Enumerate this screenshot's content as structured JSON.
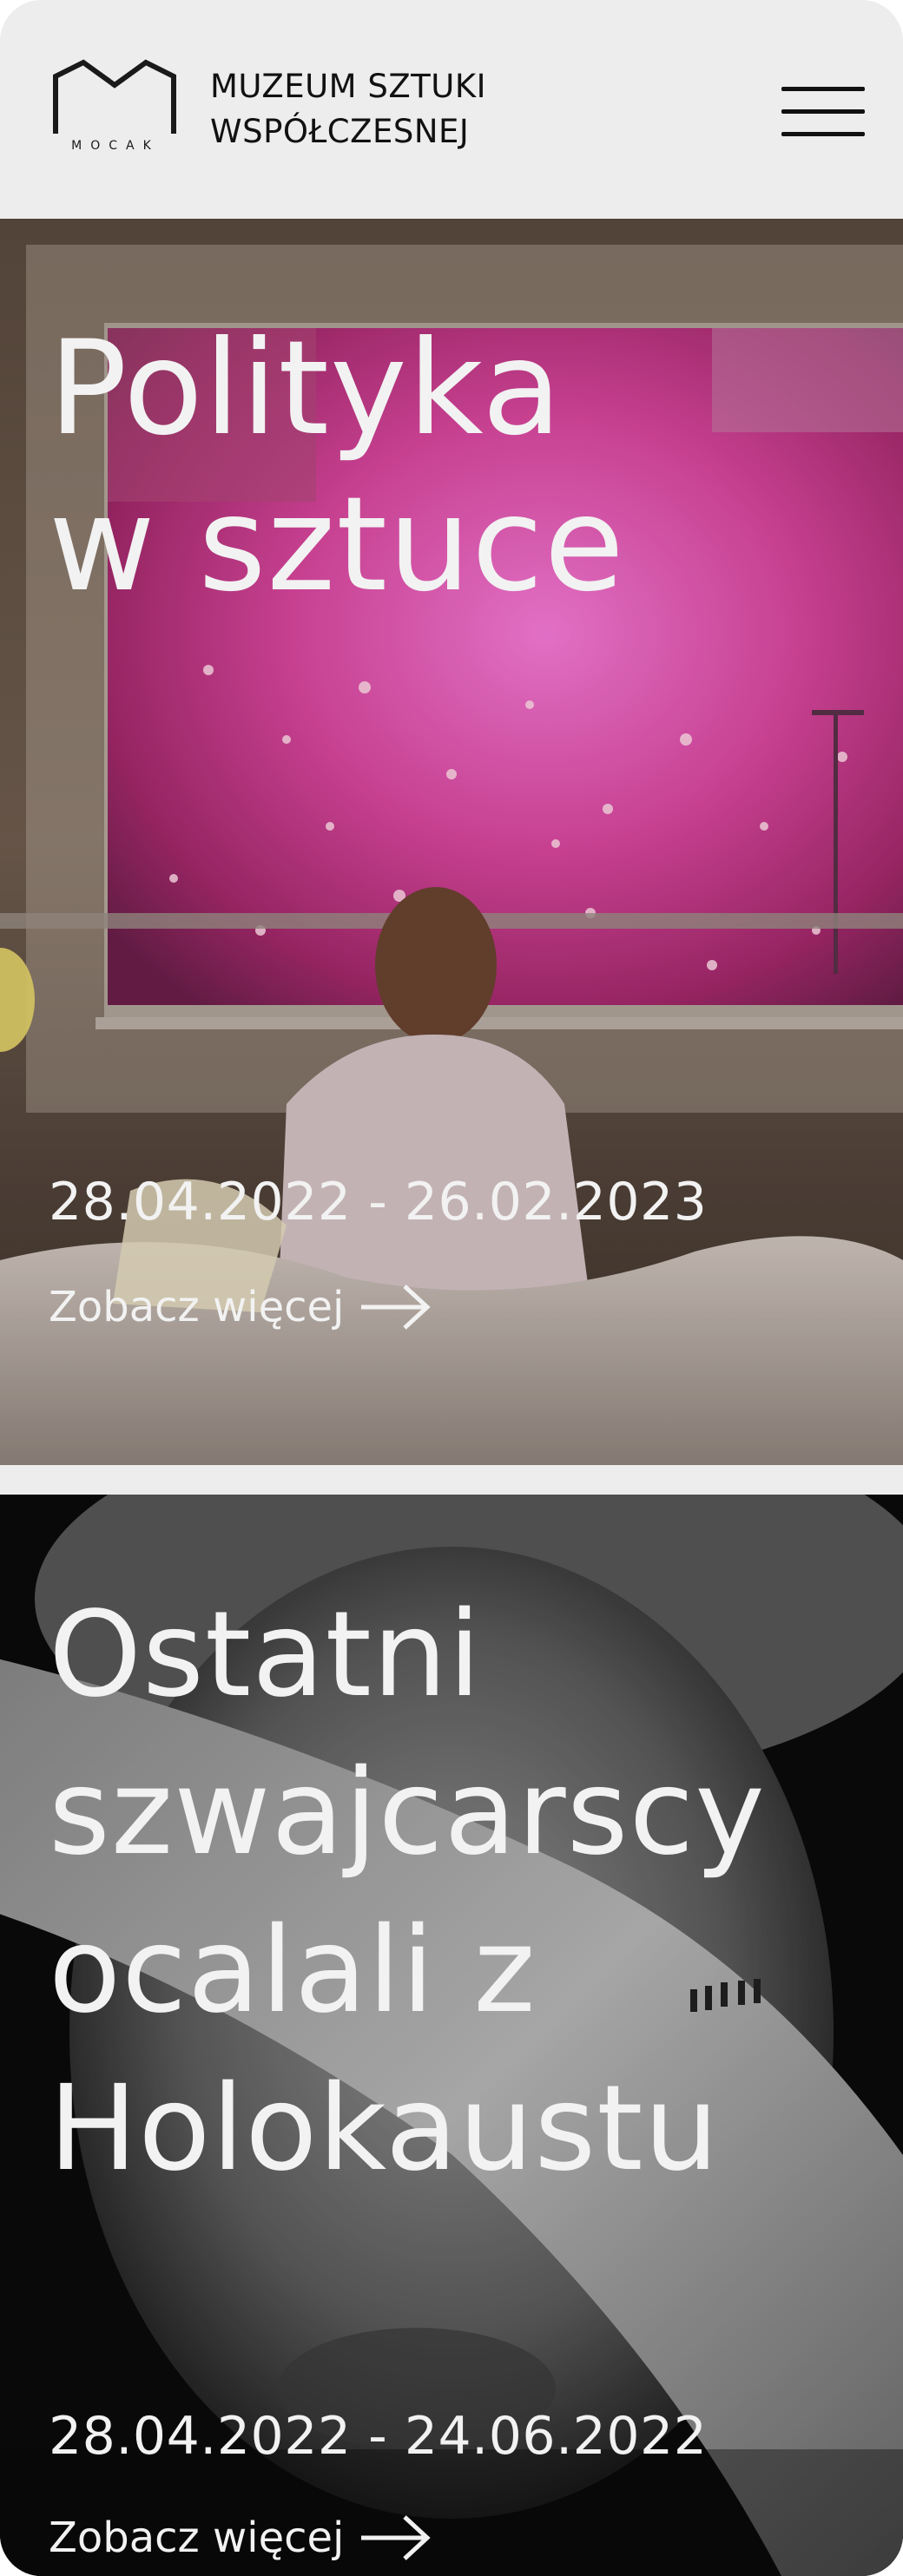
{
  "header": {
    "logo_text": "MOCAK",
    "brand_line1": "MUZEUM SZTUKI",
    "brand_line2": "WSPÓŁCZESNEJ",
    "menu_icon": "hamburger-icon"
  },
  "exhibitions": [
    {
      "title_line1": "Polityka",
      "title_line2": "w sztuce",
      "dates": "28.04.2022 - 26.02.2023",
      "link_label": "Zobacz więcej",
      "link_icon": "arrow-right-icon"
    },
    {
      "title_line1": "Ostatni",
      "title_line2": "szwajcarscy",
      "title_line3": "ocalali z",
      "title_line4": "Holokaustu",
      "dates": "28.04.2022 - 24.06.2022",
      "link_label": "Zobacz więcej",
      "link_icon": "arrow-right-icon"
    }
  ],
  "colors": {
    "header_bg": "#ededed",
    "text_light": "#f2f2f2",
    "text_dark": "#111111"
  }
}
